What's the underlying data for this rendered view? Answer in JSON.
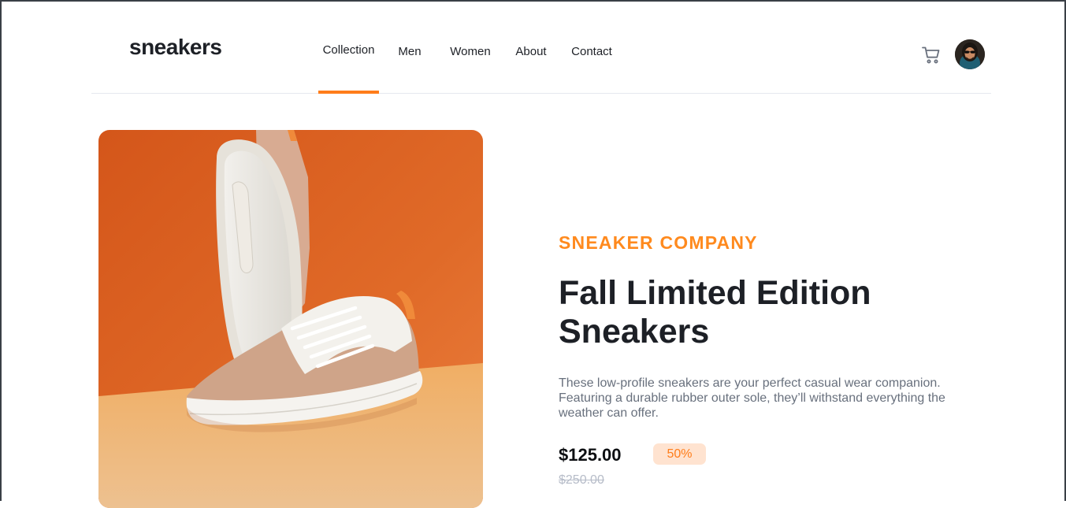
{
  "brand": {
    "logo": "sneakers"
  },
  "nav": {
    "items": [
      "Collection",
      "Men",
      "Women",
      "About",
      "Contact"
    ],
    "active": "Collection"
  },
  "header_icons": [
    "cart-icon",
    "avatar"
  ],
  "product": {
    "company": "SNEAKER COMPANY",
    "title": "Fall Limited Edition Sneakers",
    "description": "These low-profile sneakers are your perfect casual wear companion. Featuring a durable rubber outer sole, they’ll withstand everything the weather can offer.",
    "price": "$125.00",
    "discount": "50%",
    "old_price": "$250.00"
  },
  "colors": {
    "accent": "#ff7d1a",
    "pale_accent": "#ffe3d0",
    "dark_text": "#1d2026",
    "muted_text": "#68707d"
  }
}
